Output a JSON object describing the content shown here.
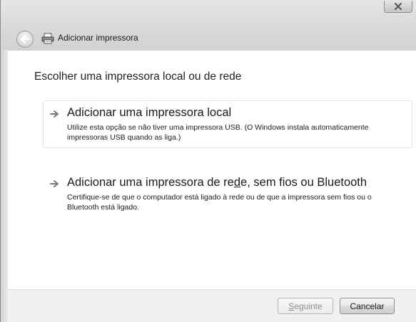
{
  "window": {
    "title": "Adicionar impressora",
    "close_label": "✕"
  },
  "main": {
    "heading": "Escolher uma impressora local ou de rede",
    "options": [
      {
        "title": "Adicionar uma impressora local",
        "description": "Utilize esta opção se não tiver uma impressora USB. (O Windows instala automaticamente impressoras USB quando as liga.)"
      },
      {
        "title_before": "Adicionar uma impressora de re",
        "title_underlined": "d",
        "title_after": "e, sem fios ou Bluetooth",
        "description": "Certifique-se de que o computador está ligado à rede ou de que a impressora sem fios ou o Bluetooth está ligado."
      }
    ]
  },
  "footer": {
    "next_underlined": "S",
    "next_rest": "eguinte",
    "cancel_label": "Cancelar"
  },
  "colors": {
    "chrome": "#dcdcdc",
    "content_bg": "#ffffff",
    "footer_bg": "#f0f0f0",
    "disabled_text": "#8d8d8d"
  },
  "icons": [
    "close-icon",
    "back-arrow-icon",
    "printer-icon",
    "option-arrow-icon"
  ]
}
